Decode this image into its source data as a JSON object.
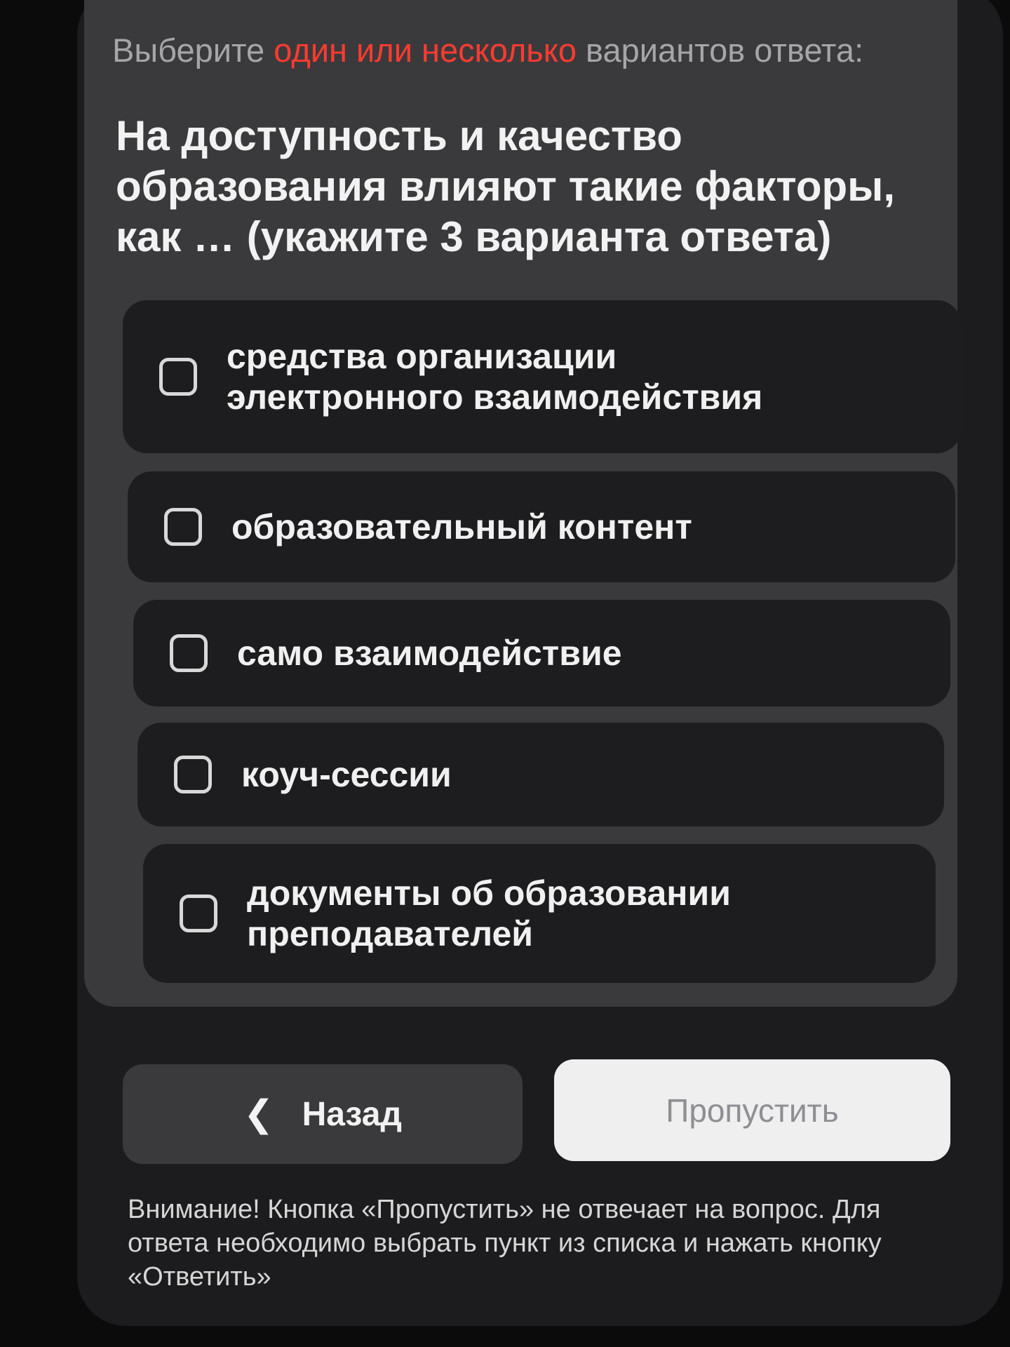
{
  "instruction": {
    "prefix": "Выберите ",
    "highlight": "один или несколько",
    "suffix": " вариантов ответа:"
  },
  "question": {
    "text": "На доступность и качество образования влияют такие факторы, как … (укажите 3 варианта ответа)"
  },
  "options": [
    {
      "label": "средства организации электронного взаимодействия"
    },
    {
      "label": "образовательный контент"
    },
    {
      "label": "само взаимодействие"
    },
    {
      "label": "коуч-сессии"
    },
    {
      "label": "документы об образовании преподавателей"
    }
  ],
  "buttons": {
    "back_icon": "chevron-left-icon",
    "back_label": "Назад",
    "skip_label": "Пропустить"
  },
  "notice": {
    "text": "Внимание! Кнопка «Пропустить» не отвечает на вопрос. Для ответа необходимо выбрать пункт из списка и нажать кнопку «Ответить»"
  },
  "colors": {
    "highlight": "#ff3b30",
    "card": "#3a3a3c",
    "option_bg": "#1d1d1f",
    "skip_bg": "#efefef"
  }
}
